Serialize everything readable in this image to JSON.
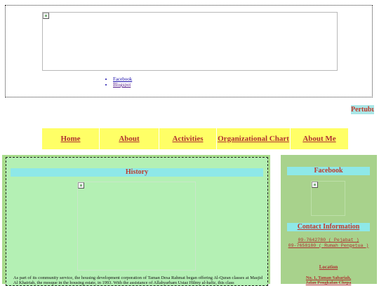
{
  "header": {
    "social_links": [
      {
        "label": "Facebook"
      },
      {
        "label": "Blogspot"
      }
    ]
  },
  "ticker": {
    "text": "Pertubuhan"
  },
  "nav": {
    "items": [
      {
        "label": "Home"
      },
      {
        "label": "About"
      },
      {
        "label": "Activities"
      },
      {
        "label": "Organizational Chart"
      },
      {
        "label": "About Me"
      }
    ]
  },
  "history": {
    "title": "History",
    "text": "As part of its community service, the housing development corporation of Taman Desa Rahmat began offering Al-Quran classes at Masjid Al Khairiah, the mosque in the housing estate, in 1993. With the assistance of Allahyarham Ustaz Hilmy al-hafiz, this class"
  },
  "sidebar": {
    "facebook_title": "Facebook",
    "contact_title": "Contact Information",
    "phones": [
      "09-7642780 ( Pejabat )",
      "09-7658180 ( Rumah Pengetua )"
    ],
    "location_title": "Location",
    "address": [
      "No. 1, Taman Sabariah,",
      "Jalan Pengkalan Chepa"
    ]
  },
  "colors": {
    "nav_bg": "#ffff66",
    "heading_bar": "#8ee8e8",
    "heading_text": "#c0392b",
    "main_panel": "#b4f0b4",
    "side_panel": "#a8d28c"
  }
}
